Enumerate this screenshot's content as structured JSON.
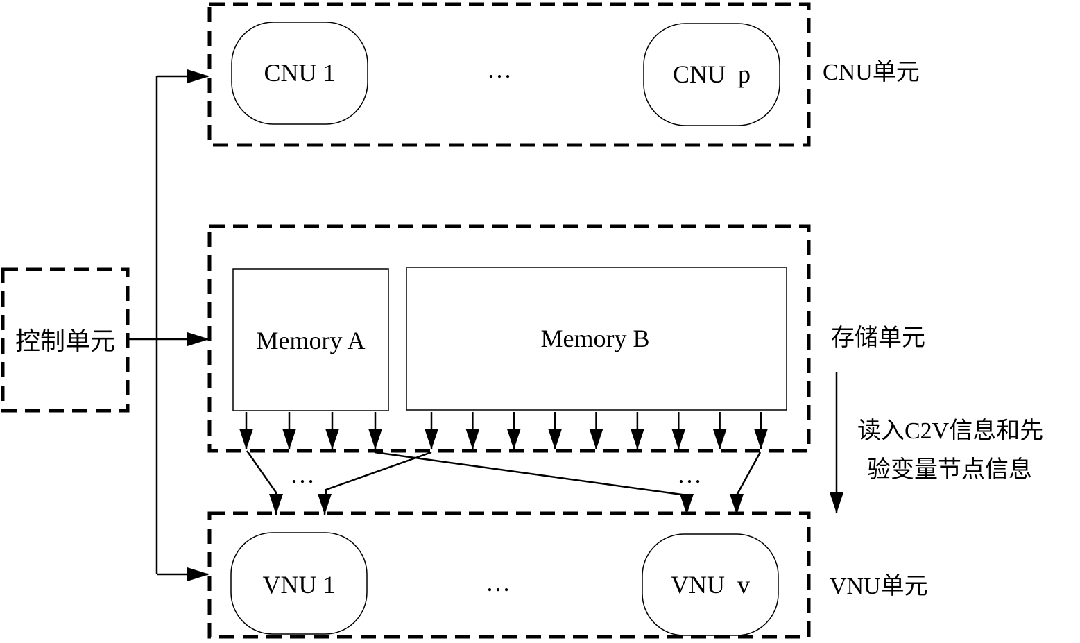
{
  "diagram": {
    "control_unit": {
      "label": "控制单元"
    },
    "cnu_unit": {
      "label": "CNU单元",
      "nodes": [
        "CNU 1",
        "CNU  p"
      ],
      "ellipsis": "…"
    },
    "storage_unit": {
      "label": "存储单元",
      "memories": [
        "Memory A",
        "Memory B"
      ],
      "memory_a_outputs": 4,
      "memory_b_outputs": 9
    },
    "vnu_unit": {
      "label": "VNU单元",
      "nodes": [
        "VNU 1",
        "VNU  v"
      ],
      "ellipsis": "…"
    },
    "interconnect": {
      "ellipsis_left": "…",
      "ellipsis_right": "…"
    },
    "flow_annotation": {
      "line1": "读入C2V信息和先",
      "line2": "验变量节点信息"
    },
    "colors": {
      "stroke": "#000000",
      "background": "#ffffff"
    }
  }
}
